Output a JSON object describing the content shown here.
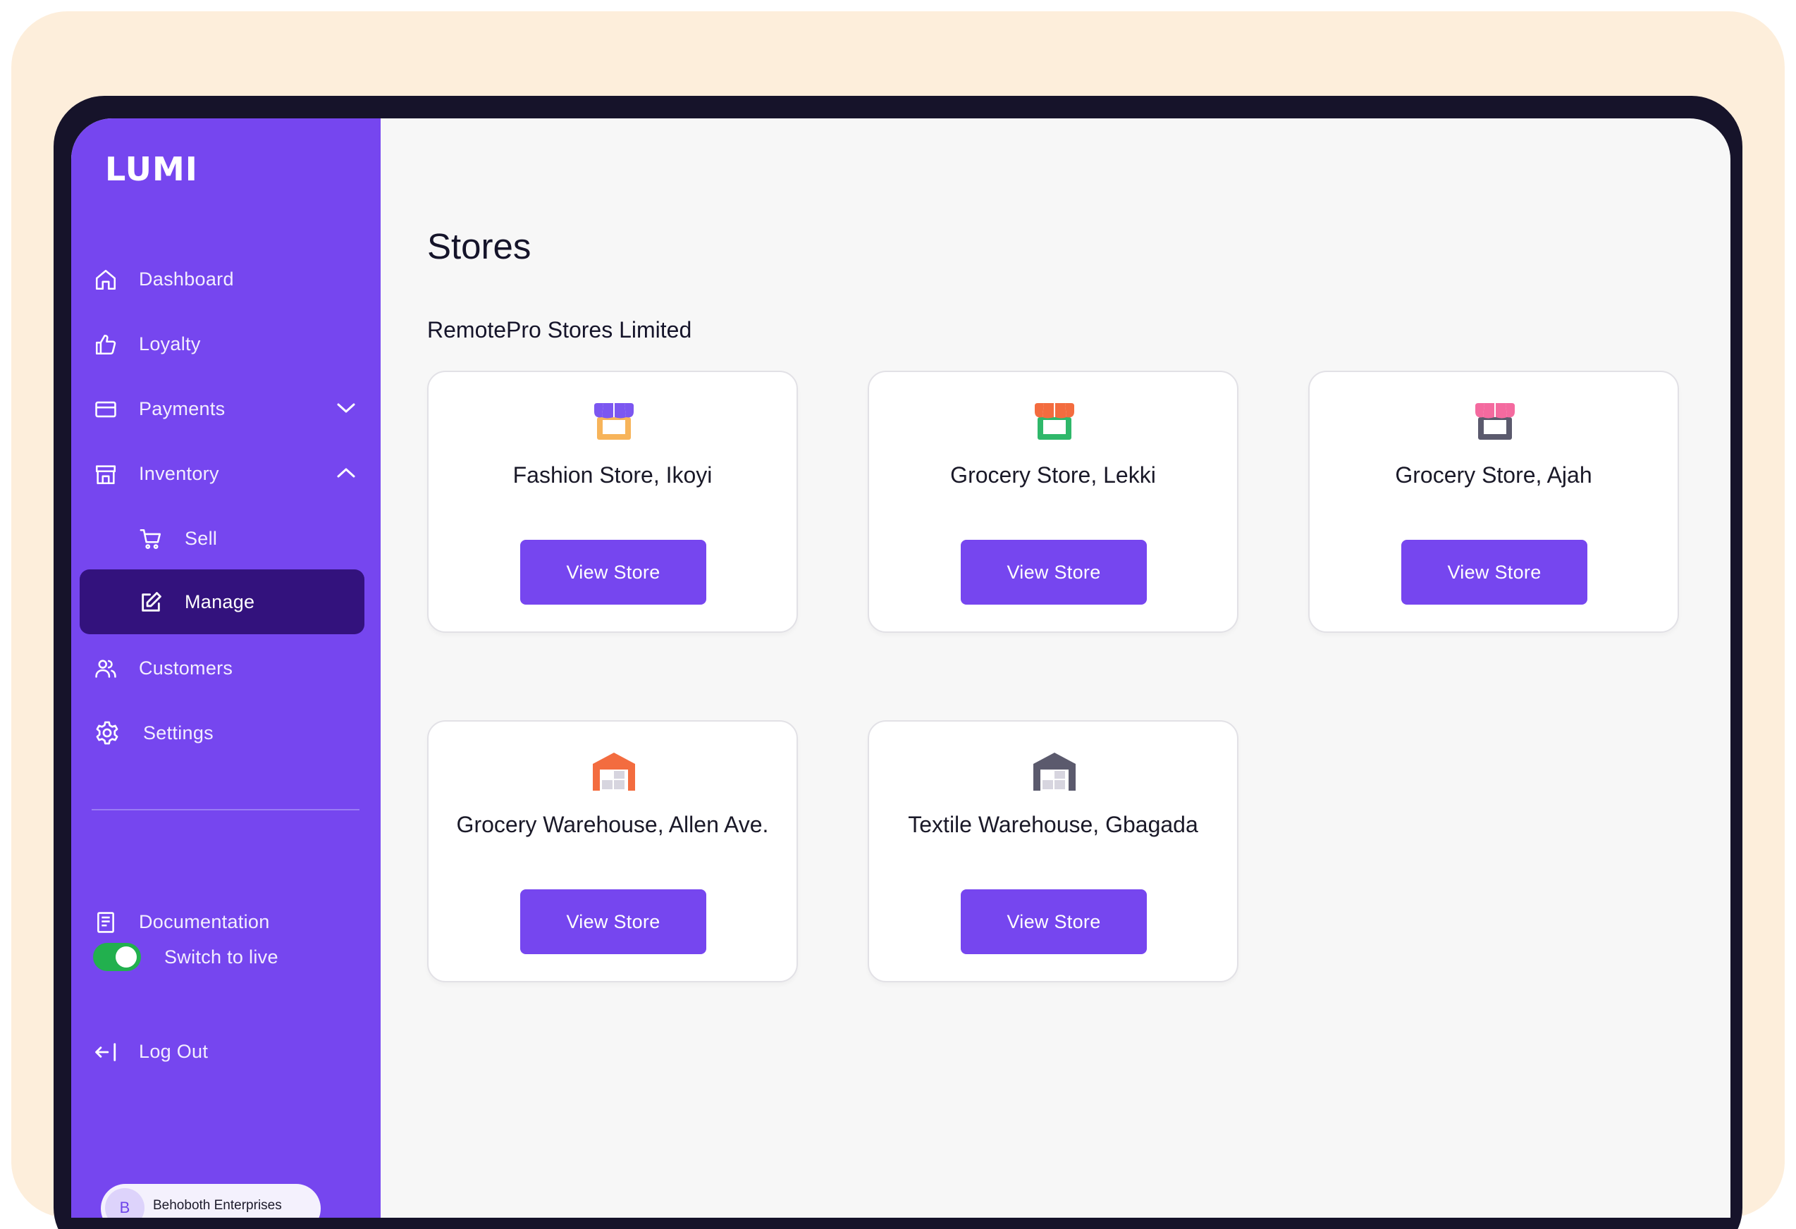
{
  "app": {
    "brand": "LUMI"
  },
  "sidebar": {
    "items": [
      {
        "label": "Dashboard",
        "icon": "home-icon"
      },
      {
        "label": "Loyalty",
        "icon": "thumbs-up-icon"
      },
      {
        "label": "Payments",
        "icon": "card-icon",
        "expanded": false
      },
      {
        "label": "Inventory",
        "icon": "store-icon",
        "expanded": true
      },
      {
        "label": "Sell",
        "icon": "cart-icon",
        "sub": true
      },
      {
        "label": "Manage",
        "icon": "edit-icon",
        "sub": true,
        "active": true
      },
      {
        "label": "Customers",
        "icon": "users-icon"
      },
      {
        "label": "Settings",
        "icon": "gear-icon"
      }
    ],
    "bottom": {
      "documentation": "Documentation",
      "switch_live": "Switch to live",
      "switch_on": true,
      "logout": "Log Out"
    },
    "account": {
      "initial": "B",
      "name": "Behoboth Enterprises"
    }
  },
  "main": {
    "title": "Stores",
    "org": "RemotePro Stores Limited",
    "stores": [
      {
        "name": "Fashion Store, Ikoyi",
        "type": "store",
        "awning": "#7c57f0",
        "base": "#f7b45a",
        "button": "View Store"
      },
      {
        "name": "Grocery Store, Lekki",
        "type": "store",
        "awning": "#f36c3f",
        "base": "#2fb86a",
        "button": "View Store"
      },
      {
        "name": "Grocery Store, Ajah",
        "type": "store",
        "awning": "#f46a9f",
        "base": "#5b5a6d",
        "button": "View Store"
      },
      {
        "name": "Grocery Warehouse, Allen Ave.",
        "type": "warehouse",
        "color": "#f36c3f",
        "button": "View Store"
      },
      {
        "name": "Textile Warehouse, Gbagada",
        "type": "warehouse",
        "color": "#5b5a6d",
        "button": "View Store"
      }
    ]
  },
  "colors": {
    "accent": "#7646ef",
    "active_nav": "#33127d",
    "backdrop": "#fdeedb",
    "toggle": "#22b04e"
  }
}
